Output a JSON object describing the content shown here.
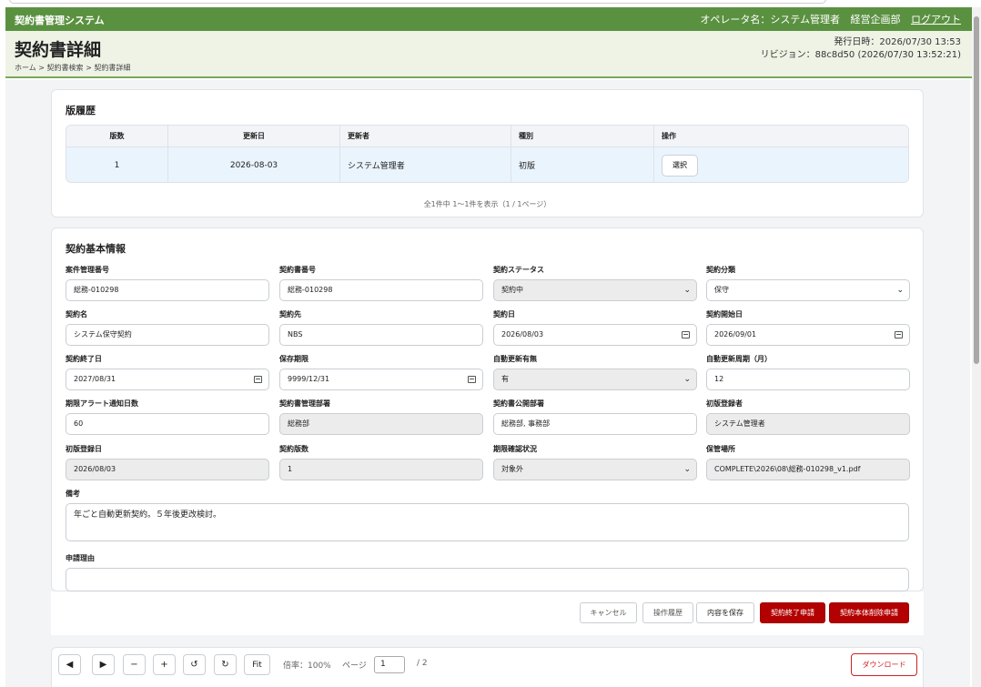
{
  "header": {
    "system_name": "契約書管理システム",
    "operator": "オペレータ名：システム管理者",
    "department": "経営企画部",
    "logout": "ログアウト"
  },
  "page": {
    "title": "契約書詳細",
    "breadcrumb": "ホーム > 契約書検索 > 契約書詳細",
    "issued": "発行日時：2026/07/30 13:53",
    "revision": "リビジョン：88c8d50 (2026/07/30 13:52:21)"
  },
  "history": {
    "title": "版履歴",
    "columns": [
      "版数",
      "更新日",
      "更新者",
      "種別",
      "操作"
    ],
    "rows": [
      {
        "version": "1",
        "updated": "2026-08-03",
        "updater": "システム管理者",
        "kind": "初版",
        "action": "選択"
      }
    ],
    "pager": "全1件中 1〜1件を表示（1 / 1ページ）"
  },
  "basic": {
    "title": "契約基本情報",
    "fields": [
      {
        "label": "案件管理番号",
        "value": "総務-010298"
      },
      {
        "label": "契約書番号",
        "value": "総務-010298"
      },
      {
        "label": "契約ステータス",
        "value": "契約中"
      },
      {
        "label": "契約分類",
        "value": "保守"
      },
      {
        "label": "契約名",
        "value": "システム保守契約"
      },
      {
        "label": "契約先",
        "value": "NBS"
      },
      {
        "label": "契約日",
        "value": "2026/08/03"
      },
      {
        "label": "契約開始日",
        "value": "2026/09/01"
      },
      {
        "label": "契約終了日",
        "value": "2027/08/31"
      },
      {
        "label": "保存期限",
        "value": "9999/12/31"
      },
      {
        "label": "自動更新有無",
        "value": "有"
      },
      {
        "label": "自動更新周期（月）",
        "value": "12"
      },
      {
        "label": "期限アラート通知日数",
        "value": "60"
      },
      {
        "label": "契約書管理部署",
        "value": "総務部"
      },
      {
        "label": "契約書公開部署",
        "value": "総務部, 事務部"
      },
      {
        "label": "初版登録者",
        "value": "システム管理者"
      },
      {
        "label": "初版登録日",
        "value": "2026/08/03"
      },
      {
        "label": "契約版数",
        "value": "1"
      },
      {
        "label": "期限確認状況",
        "value": "対象外"
      },
      {
        "label": "保管場所",
        "value": "COMPLETE\\2026\\08\\総務-010298_v1.pdf"
      }
    ],
    "remarks_label": "備考",
    "remarks_value": "年ごと自動更新契約。５年後更改検討。",
    "reason_label": "申請理由",
    "reason_value": ""
  },
  "actions": {
    "cancel": "キャンセル",
    "history": "操作履歴",
    "save": "内容を保存",
    "end_request": "契約終了申請",
    "delete_request": "契約本体削除申請"
  },
  "viewer": {
    "prev": "◀",
    "next": "▶",
    "zoom_out": "−",
    "zoom_in": "+",
    "rotate_left": "↺",
    "rotate_right": "↻",
    "fit": "Fit",
    "zoom": "倍率：100%",
    "page_label": "ページ",
    "page_value": "1",
    "page_total": "/ 2",
    "download": "ダウンロード"
  }
}
